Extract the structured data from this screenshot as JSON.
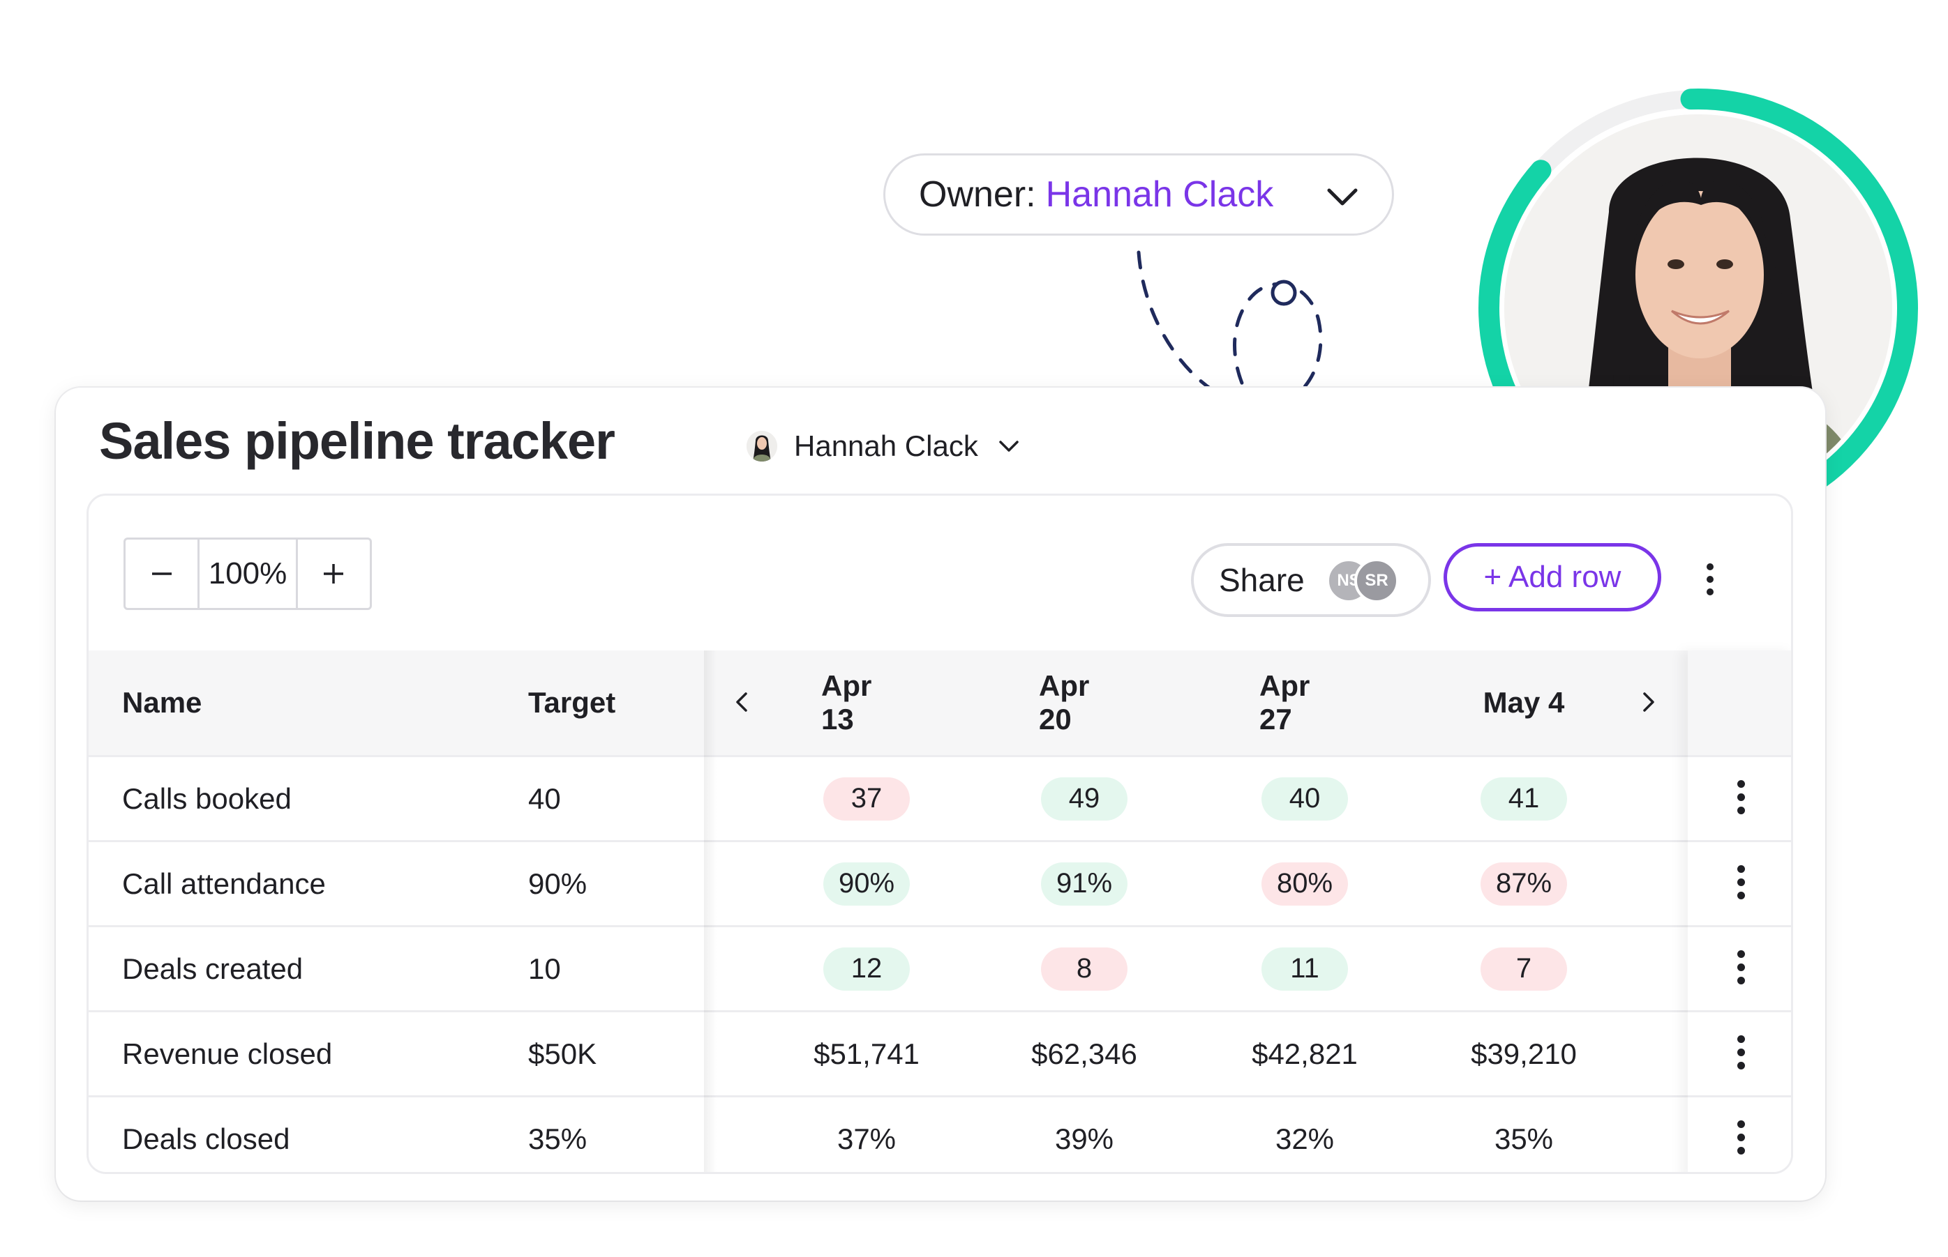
{
  "owner_filter": {
    "label": "Owner:",
    "value": "Hannah Clack"
  },
  "avatar": {
    "ring_color": "#14d3a7",
    "description_icon": "user-photo"
  },
  "card": {
    "title": "Sales pipeline tracker",
    "owner_name": "Hannah Clack"
  },
  "toolbar": {
    "zoom_value": "100%",
    "share_label": "Share",
    "share_avatars": [
      "NS",
      "SR"
    ],
    "add_row_label": "+ Add row"
  },
  "table": {
    "headers": {
      "name": "Name",
      "target": "Target",
      "weeks": [
        "Apr 13",
        "Apr 20",
        "Apr 27",
        "May 4"
      ]
    },
    "rows": [
      {
        "name": "Calls booked",
        "target": "40",
        "values": [
          "37",
          "49",
          "40",
          "41"
        ],
        "status": [
          "bad",
          "good",
          "good",
          "good"
        ]
      },
      {
        "name": "Call attendance",
        "target": "90%",
        "values": [
          "90%",
          "91%",
          "80%",
          "87%"
        ],
        "status": [
          "good",
          "good",
          "bad",
          "bad"
        ]
      },
      {
        "name": "Deals created",
        "target": "10",
        "values": [
          "12",
          "8",
          "11",
          "7"
        ],
        "status": [
          "good",
          "bad",
          "good",
          "bad"
        ]
      },
      {
        "name": "Revenue closed",
        "target": "$50K",
        "values": [
          "$51,741",
          "$62,346",
          "$42,821",
          "$39,210"
        ],
        "status": [
          "none",
          "none",
          "none",
          "none"
        ]
      },
      {
        "name": "Deals closed",
        "target": "35%",
        "values": [
          "37%",
          "39%",
          "32%",
          "35%"
        ],
        "status": [
          "none",
          "none",
          "none",
          "none"
        ]
      }
    ]
  },
  "colors": {
    "accent": "#7a35e8",
    "good_bg": "#e4f7ee",
    "bad_bg": "#fde5e7",
    "ring": "#14d3a7"
  }
}
